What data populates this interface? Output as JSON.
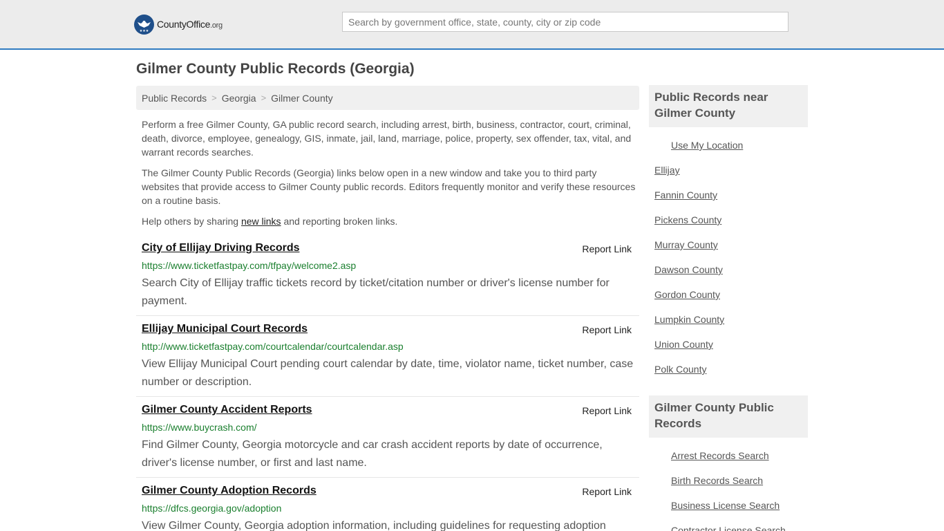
{
  "header": {
    "logo_text": "CountyOffice",
    "logo_suffix": ".org",
    "search_placeholder": "Search by government office, state, county, city or zip code"
  },
  "page": {
    "title": "Gilmer County Public Records (Georgia)"
  },
  "breadcrumb": {
    "items": [
      "Public Records",
      "Georgia",
      "Gilmer County"
    ],
    "separator": ">"
  },
  "intro": {
    "p1": "Perform a free Gilmer County, GA public record search, including arrest, birth, business, contractor, court, criminal, death, divorce, employee, genealogy, GIS, inmate, jail, land, marriage, police, property, sex offender, tax, vital, and warrant records searches.",
    "p2": "The Gilmer County Public Records (Georgia) links below open in a new window and take you to third party websites that provide access to Gilmer County public records. Editors frequently monitor and verify these resources on a routine basis.",
    "p3_before": "Help others by sharing",
    "p3_link": "new links",
    "p3_after": "and reporting broken links."
  },
  "records": [
    {
      "title": "City of Ellijay Driving Records",
      "report": "Report Link",
      "url": "https://www.ticketfastpay.com/tfpay/welcome2.asp",
      "description": "Search City of Ellijay traffic tickets record by ticket/citation number or driver's license number for payment."
    },
    {
      "title": "Ellijay Municipal Court Records",
      "report": "Report Link",
      "url": "http://www.ticketfastpay.com/courtcalendar/courtcalendar.asp",
      "description": "View Ellijay Municipal Court pending court calendar by date, time, violator name, ticket number, case number or description."
    },
    {
      "title": "Gilmer County Accident Reports",
      "report": "Report Link",
      "url": "https://www.buycrash.com/",
      "description": "Find Gilmer County, Georgia motorcycle and car crash accident reports by date of occurrence, driver's license number, or first and last name."
    },
    {
      "title": "Gilmer County Adoption Records",
      "report": "Report Link",
      "url": "https://dfcs.georgia.gov/adoption",
      "description": "View Gilmer County, Georgia adoption information, including guidelines for requesting adoption"
    }
  ],
  "sidebar": {
    "near_title": "Public Records near Gilmer County",
    "use_location": "Use My Location",
    "near_links": [
      "Ellijay",
      "Fannin County",
      "Pickens County",
      "Murray County",
      "Dawson County",
      "Gordon County",
      "Lumpkin County",
      "Union County",
      "Polk County"
    ],
    "county_title": "Gilmer County Public Records",
    "county_links": [
      "Arrest Records Search",
      "Birth Records Search",
      "Business License Search",
      "Contractor License Search"
    ]
  },
  "colors": {
    "accent": "#2f7bc1",
    "url_green": "#1a7f2e",
    "logo_blue": "#1f4f8a"
  }
}
